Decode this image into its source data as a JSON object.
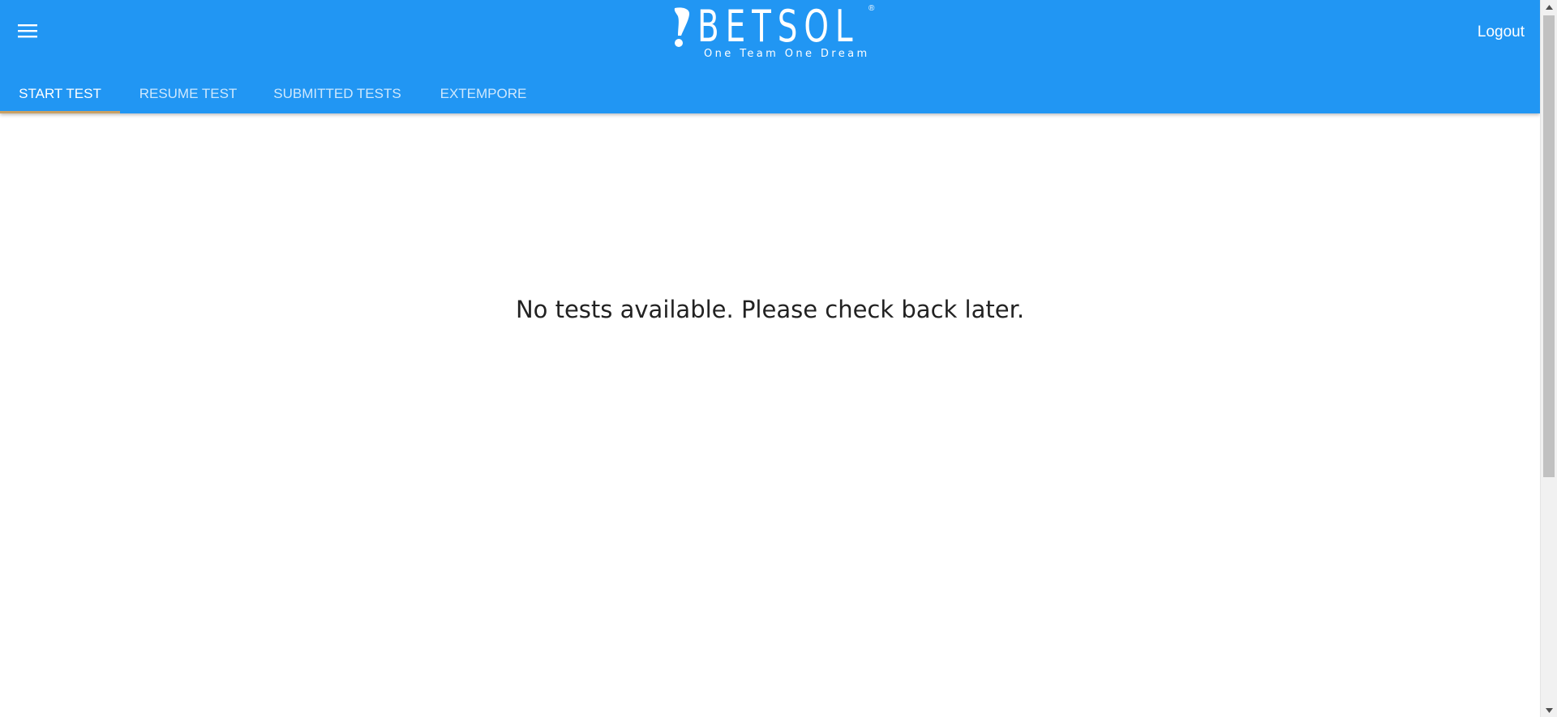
{
  "colors": {
    "primary": "#2196F3",
    "tab_indicator": "#C9A063",
    "text": "#222222"
  },
  "header": {
    "menu_icon": "hamburger-menu-icon",
    "logo": {
      "wordmark": "BETSOL",
      "registered": "®",
      "tagline": "One Team One Dream"
    },
    "logout_label": "Logout"
  },
  "tabs": [
    {
      "label": "START TEST",
      "active": true
    },
    {
      "label": "RESUME TEST",
      "active": false
    },
    {
      "label": "SUBMITTED TESTS",
      "active": false
    },
    {
      "label": "EXTEMPORE",
      "active": false
    }
  ],
  "main": {
    "empty_message": "No tests available. Please check back later."
  },
  "scrollbar": {
    "up_icon": "arrow-up-icon",
    "down_icon": "arrow-down-icon"
  }
}
